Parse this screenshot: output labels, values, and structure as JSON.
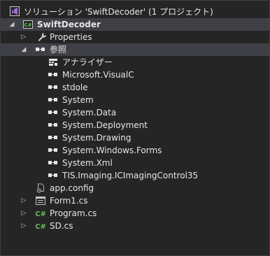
{
  "solution_label": "ソリューション 'SwiftDecoder' (1 プロジェクト)",
  "project_label": "SwiftDecoder",
  "properties_label": "Properties",
  "references_label": "参照",
  "references": [
    "アナライザー",
    "Microsoft.VisualC",
    "stdole",
    "System",
    "System.Data",
    "System.Deployment",
    "System.Drawing",
    "System.Windows.Forms",
    "System.Xml",
    "TIS.Imaging.ICImagingControl35"
  ],
  "files": {
    "app_config": "app.config",
    "form1": "Form1.cs",
    "program": "Program.cs",
    "sd": "SD.cs"
  },
  "colors": {
    "background": "#252526",
    "selection": "#3f3f46",
    "csharp_green": "#68c25a",
    "vs_purple": "#9b6fd0",
    "wrench_gray": "#c8c8c8"
  },
  "icons": {
    "solution": "visual-studio-solution-icon",
    "project": "csharp-project-icon",
    "properties": "wrench-icon",
    "references": "reference-icon",
    "analyzer": "analyzer-icon",
    "config": "config-file-icon",
    "form": "form-icon",
    "csharp_file": "csharp-file-icon"
  }
}
